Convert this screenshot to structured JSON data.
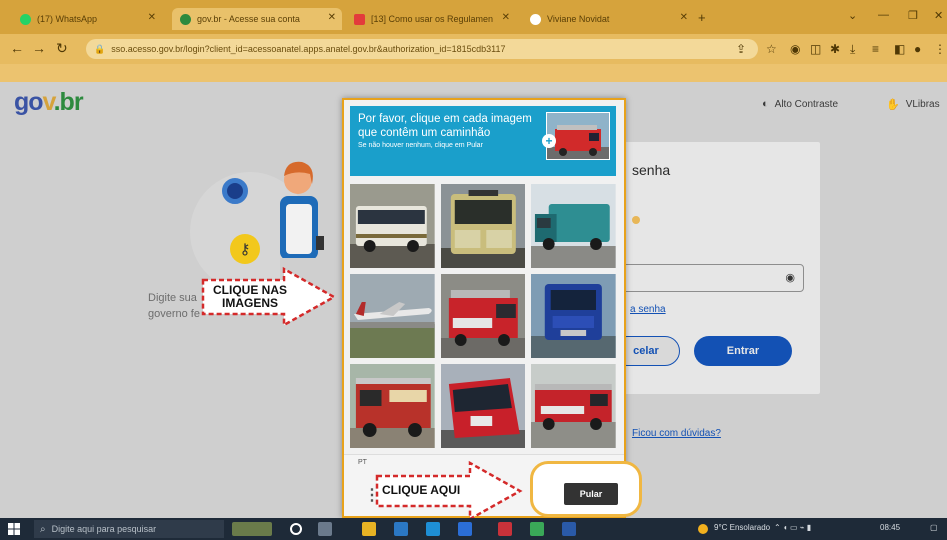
{
  "browser": {
    "tabs": [
      {
        "label": "(17) WhatsApp",
        "favicon_color": "#25d366"
      },
      {
        "label": "gov.br - Acesse sua conta",
        "favicon_color": "#2d8a3e"
      },
      {
        "label": "[13] Como usar os Regulamen",
        "favicon_color": "#e33b3b"
      },
      {
        "label": "Viviane Novidat",
        "favicon_color": "#ffffff"
      }
    ],
    "url": "sso.acesso.gov.br/login?client_id=acessoanatel.apps.anatel.gov.br&authorization_id=1815cdb3117"
  },
  "header": {
    "logo": {
      "g": "go",
      "v": "v",
      "b": ".br"
    },
    "contrast": "Alto Contraste",
    "vlibras": "VLibras"
  },
  "left_panel": {
    "text_line1": "Digite sua",
    "text_line1b": "gi",
    "text_line2": "governo fe"
  },
  "login": {
    "title": "senha",
    "forgot": "a senha",
    "cancel": "celar",
    "enter": "Entrar",
    "doubts": "Ficou com dúvidas?"
  },
  "captcha": {
    "prompt": "Por favor, clique em cada imagem que contêm um caminhão",
    "sub": "Se não houver nenhum, clique em Pular",
    "lang": "PT",
    "skip": "Pular",
    "images": [
      {
        "name": "bus-white",
        "kind": "bus"
      },
      {
        "name": "bus-yellow",
        "kind": "bus"
      },
      {
        "name": "garbage-truck-teal",
        "kind": "truck"
      },
      {
        "name": "airplane",
        "kind": "plane"
      },
      {
        "name": "fire-truck-red",
        "kind": "firetruck"
      },
      {
        "name": "truck-blue",
        "kind": "truck"
      },
      {
        "name": "fire-truck-old",
        "kind": "firetruck"
      },
      {
        "name": "bus-red",
        "kind": "bus"
      },
      {
        "name": "fire-truck-parked",
        "kind": "firetruck"
      }
    ]
  },
  "callouts": {
    "images": "CLIQUE NAS IMAGENS",
    "here": "CLIQUE AQUI"
  },
  "taskbar": {
    "search": "Digite aqui para pesquisar",
    "weather": "9°C Ensolarado",
    "time": "08:45"
  }
}
